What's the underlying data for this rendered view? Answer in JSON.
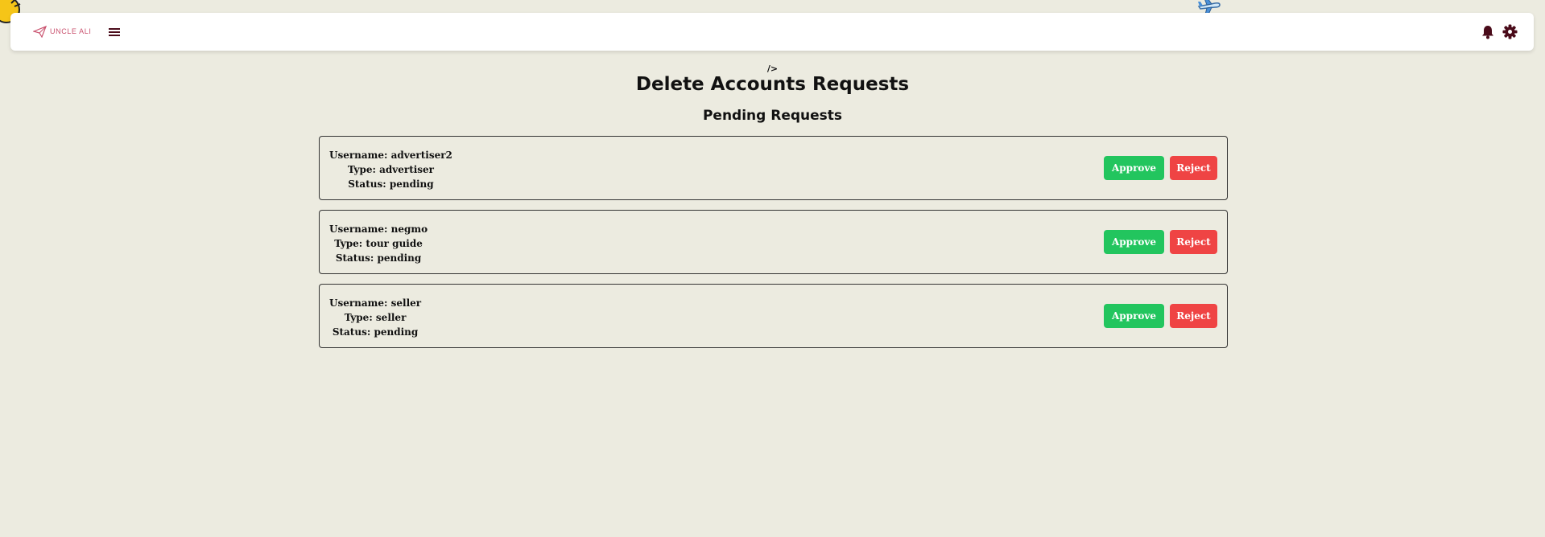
{
  "navbar": {
    "logo_text": "UNCLE ALI"
  },
  "stray_code": "/>",
  "page_title": "Delete Accounts Requests",
  "section_title": "Pending Requests",
  "labels": {
    "username": "Username: ",
    "type": "Type: ",
    "status": "Status: "
  },
  "requests": [
    {
      "username": "advertiser2",
      "type": "advertiser",
      "status": "pending",
      "approve_label": "Approve",
      "reject_label": "Reject"
    },
    {
      "username": "negmo",
      "type": "tour guide",
      "status": "pending",
      "approve_label": "Approve",
      "reject_label": "Reject"
    },
    {
      "username": "seller",
      "type": "seller",
      "status": "pending",
      "approve_label": "Approve",
      "reject_label": "Reject"
    }
  ],
  "icons": {
    "menu": "hamburger-menu-icon",
    "bell": "bell-icon",
    "settings": "gear-icon",
    "logo": "airplane-logo-icon",
    "decor_sun": "sun-icon",
    "decor_plane": "airplane-icon"
  },
  "colors": {
    "background": "#ecebe0",
    "approve": "#22c55e",
    "reject": "#ef4444",
    "logo": "#c9516e",
    "nav_icons": "#4a0b1a"
  }
}
